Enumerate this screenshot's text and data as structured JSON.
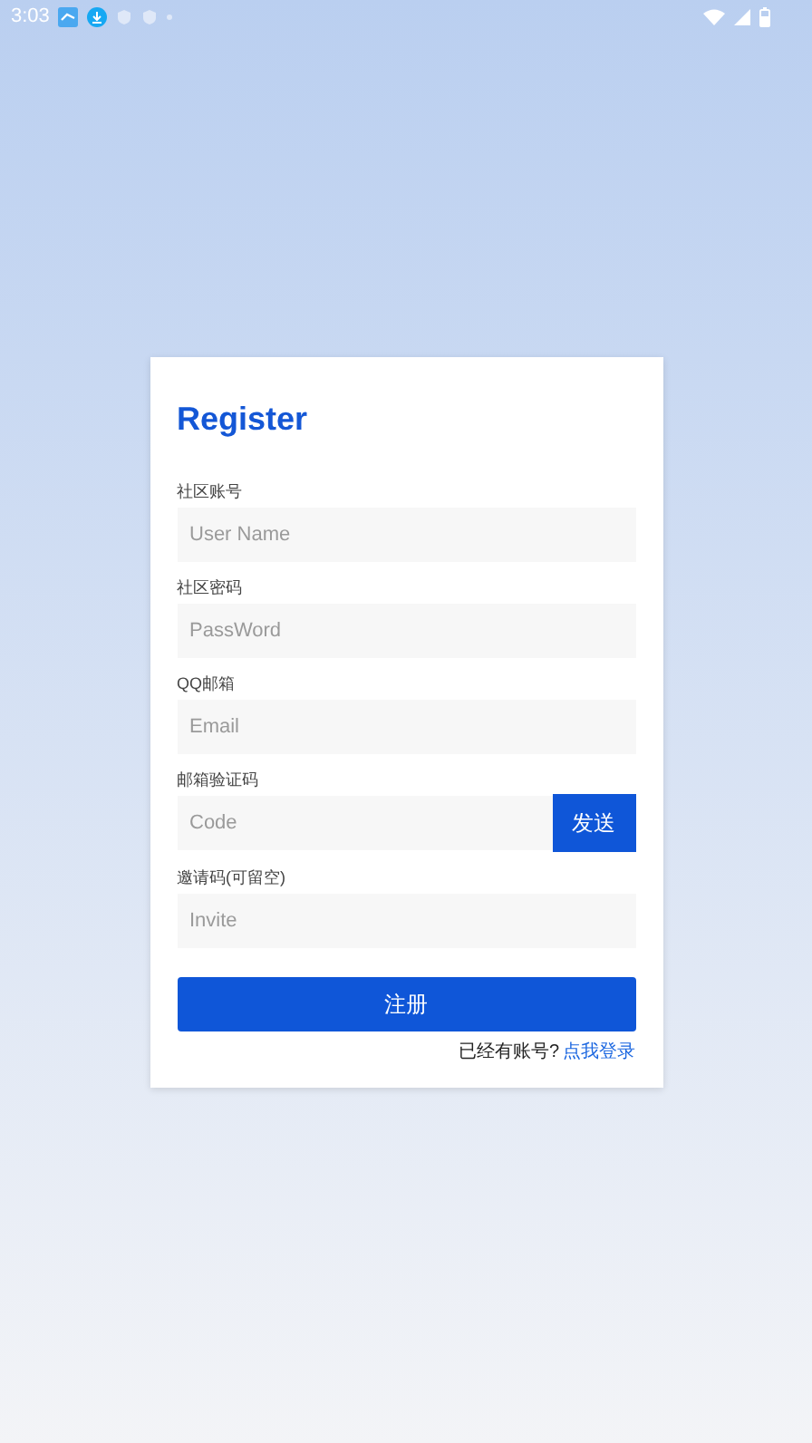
{
  "status_bar": {
    "time": "3:03"
  },
  "form": {
    "title": "Register",
    "fields": [
      {
        "kind": "plain",
        "label": "社区账号",
        "placeholder": "User Name"
      },
      {
        "kind": "plain",
        "label": "社区密码",
        "placeholder": "PassWord"
      },
      {
        "kind": "plain",
        "label": "QQ邮箱",
        "placeholder": "Email"
      },
      {
        "kind": "with_button",
        "label": "邮箱验证码",
        "placeholder": "Code",
        "button": "发送"
      },
      {
        "kind": "plain",
        "label": "邀请码(可留空)",
        "placeholder": "Invite"
      }
    ],
    "submit": "注册",
    "footer_text": "已经有账号?",
    "footer_link": "点我登录"
  }
}
